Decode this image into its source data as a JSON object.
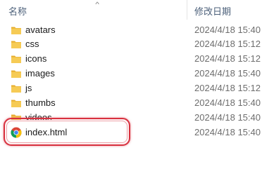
{
  "header": {
    "name_label": "名称",
    "date_label": "修改日期",
    "sort_indicator": "^"
  },
  "files": [
    {
      "name": "avatars",
      "date": "2024/4/18 15:40",
      "icon": "folder-icon"
    },
    {
      "name": "css",
      "date": "2024/4/18 15:12",
      "icon": "folder-icon"
    },
    {
      "name": "icons",
      "date": "2024/4/18 15:12",
      "icon": "folder-icon"
    },
    {
      "name": "images",
      "date": "2024/4/18 15:40",
      "icon": "folder-icon"
    },
    {
      "name": "js",
      "date": "2024/4/18 15:12",
      "icon": "folder-icon"
    },
    {
      "name": "thumbs",
      "date": "2024/4/18 15:40",
      "icon": "folder-icon"
    },
    {
      "name": "videos",
      "date": "2024/4/18 15:40",
      "icon": "folder-icon"
    },
    {
      "name": "index.html",
      "date": "2024/4/18 15:40",
      "icon": "chrome-html-icon"
    }
  ],
  "colors": {
    "highlight": "#d8313f",
    "folder": "#f3c64f",
    "header_text": "#4c607a"
  }
}
